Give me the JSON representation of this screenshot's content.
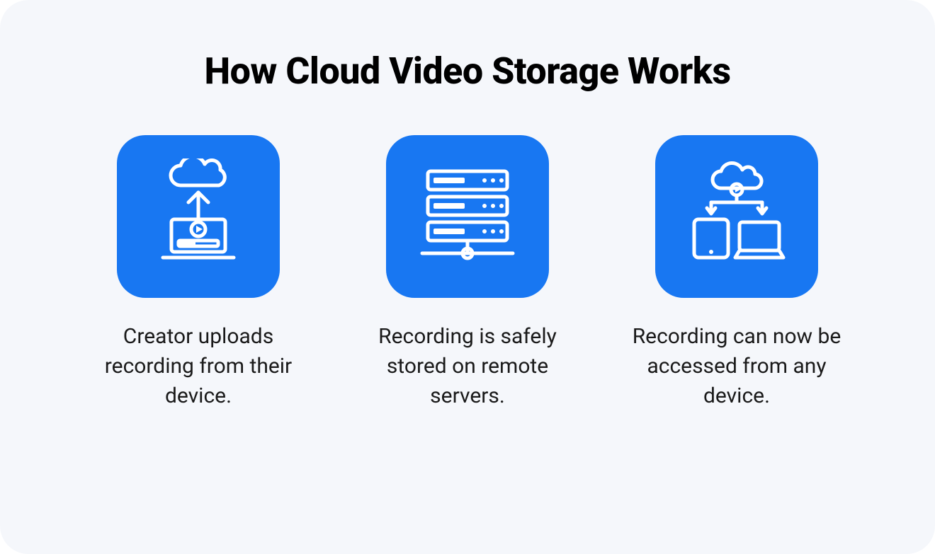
{
  "title": "How Cloud Video Storage Works",
  "accent_color": "#1877f2",
  "background_color": "#f5f7fb",
  "steps": [
    {
      "icon": "upload-to-cloud-icon",
      "caption": "Creator uploads recording from their device."
    },
    {
      "icon": "server-rack-icon",
      "caption": "Recording is safely stored on remote servers."
    },
    {
      "icon": "cloud-to-devices-icon",
      "caption": "Recording can now be accessed from any device."
    }
  ]
}
